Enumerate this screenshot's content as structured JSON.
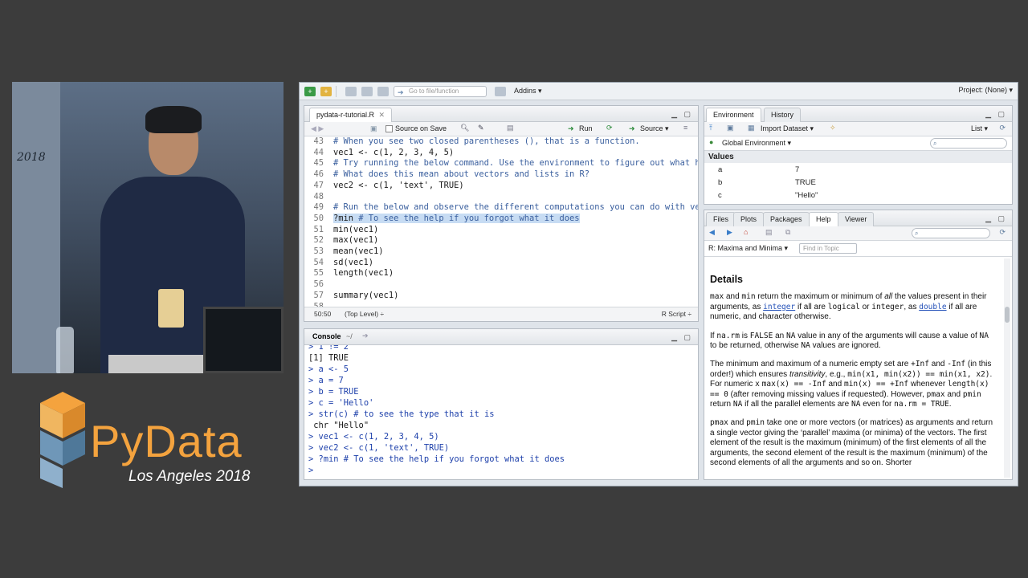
{
  "video": {
    "wall_text": "2018"
  },
  "logo": {
    "word": "PyData",
    "subtitle": "Los Angeles 2018"
  },
  "toolbar": {
    "goto_placeholder": "Go to file/function",
    "addins_label": "Addins ▾",
    "project_label": "Project: (None) ▾"
  },
  "editor": {
    "tab_label": "pydata-r-tutorial.R",
    "source_on_save": "Source on Save",
    "run_label": "Run",
    "source_label": "Source ▾",
    "lines": [
      {
        "n": "43",
        "text": "# When you see two closed parentheses (), that is a function.",
        "type": "comment"
      },
      {
        "n": "44",
        "text": "vec1 <- c(1, 2, 3, 4, 5)",
        "type": "code"
      },
      {
        "n": "45",
        "text": "# Try running the below command. Use the environment to figure out what happ",
        "type": "comment"
      },
      {
        "n": "46",
        "text": "# What does this mean about vectors and lists in R?",
        "type": "comment"
      },
      {
        "n": "47",
        "text": "vec2 <- c(1, 'text', TRUE)",
        "type": "code"
      },
      {
        "n": "48",
        "text": "",
        "type": "code"
      },
      {
        "n": "49",
        "text": "# Run the below and observe the different computations you can do with vecto",
        "type": "comment"
      },
      {
        "n": "50",
        "text": "?min # To see the help if you forgot what it does",
        "type": "selected"
      },
      {
        "n": "51",
        "text": "min(vec1)",
        "type": "code"
      },
      {
        "n": "52",
        "text": "max(vec1)",
        "type": "code"
      },
      {
        "n": "53",
        "text": "mean(vec1)",
        "type": "code"
      },
      {
        "n": "54",
        "text": "sd(vec1)",
        "type": "code"
      },
      {
        "n": "55",
        "text": "length(vec1)",
        "type": "code"
      },
      {
        "n": "56",
        "text": "",
        "type": "code"
      },
      {
        "n": "57",
        "text": "summary(vec1)",
        "type": "code"
      },
      {
        "n": "58",
        "text": "",
        "type": "code"
      }
    ],
    "status_pos": "50:50",
    "status_scope": "(Top Level) ÷",
    "status_lang": "R Script ÷"
  },
  "console": {
    "tab_label": "Console",
    "path": "~/",
    "lines": [
      {
        "text": "> 1 != 2",
        "type": "input"
      },
      {
        "text": "[1] TRUE",
        "type": "output"
      },
      {
        "text": "> a <- 5",
        "type": "input"
      },
      {
        "text": "> a = 7",
        "type": "input"
      },
      {
        "text": "> b = TRUE",
        "type": "input"
      },
      {
        "text": "> c = 'Hello'",
        "type": "input"
      },
      {
        "text": "> str(c) # to see the type that it is",
        "type": "input"
      },
      {
        "text": " chr \"Hello\"",
        "type": "output"
      },
      {
        "text": "> vec1 <- c(1, 2, 3, 4, 5)",
        "type": "input"
      },
      {
        "text": "> vec2 <- c(1, 'text', TRUE)",
        "type": "input"
      },
      {
        "text": "> ?min # To see the help if you forgot what it does",
        "type": "input"
      },
      {
        "text": "> ",
        "type": "input"
      }
    ]
  },
  "environment": {
    "tabs": [
      "Environment",
      "History"
    ],
    "import_label": "Import Dataset ▾",
    "list_label": "List ▾",
    "scope_label": "Global Environment ▾",
    "section": "Values",
    "rows": [
      {
        "name": "a",
        "value": "7"
      },
      {
        "name": "b",
        "value": "TRUE"
      },
      {
        "name": "c",
        "value": "\"Hello\""
      }
    ]
  },
  "help": {
    "tabs": [
      "Files",
      "Plots",
      "Packages",
      "Help",
      "Viewer"
    ],
    "topic_label": "R: Maxima and Minima ▾",
    "find_placeholder": "Find in Topic",
    "heading": "Details",
    "p1": {
      "a": "max",
      "b": " and ",
      "c": "min",
      "d": " return the maximum or minimum of ",
      "e": "all",
      "f": " the values present in their arguments, as ",
      "g": "integer",
      "h": " if all are ",
      "i": "logical",
      "j": " or ",
      "k": "integer",
      "l": ", as ",
      "m": "double",
      "n": " if all are numeric, and character otherwise."
    },
    "p2": {
      "a": "If ",
      "b": "na.rm",
      "c": " is ",
      "d": "FALSE",
      "e": " an ",
      "f": "NA",
      "g": " value in any of the arguments will cause a value of ",
      "h": "NA",
      "i": " to be returned, otherwise ",
      "j": "NA",
      "k": " values are ignored."
    },
    "p3": {
      "a": "The minimum and maximum of a numeric empty set are ",
      "b": "+Inf",
      "c": " and ",
      "d": "-Inf",
      "e": " (in this order!) which ensures ",
      "f": "transitivity",
      "g": ", e.g., ",
      "h": "min(x1, min(x2)) == min(x1, x2)",
      "i": ". For numeric ",
      "j": "x",
      "k": " ",
      "l": "max(x) == -Inf",
      "m": " and ",
      "n": "min(x) == +Inf",
      "o": " whenever ",
      "p": "length(x) == 0",
      "q": " (after removing missing values if requested). However, ",
      "r": "pmax",
      "s": " and ",
      "t": "pmin",
      "u": " return ",
      "v": "NA",
      "w": " if all the parallel elements are ",
      "x": "NA",
      "y": " even for ",
      "z": "na.rm = TRUE",
      "end": "."
    },
    "p4": {
      "a": "pmax",
      "b": " and ",
      "c": "pmin",
      "d": " take one or more vectors (or matrices) as arguments and return a single vector giving the ‘parallel’ maxima (or minima) of the vectors. The first element of the result is the maximum (minimum) of the first elements of all the arguments, the second element of the result is the maximum (minimum) of the second elements of all the arguments and so on. Shorter"
    }
  },
  "colors": {
    "accent": "#f4a33e",
    "selection": "#c7dcf3",
    "console_input": "#1c3faa",
    "comment": "#3a5f9e"
  }
}
